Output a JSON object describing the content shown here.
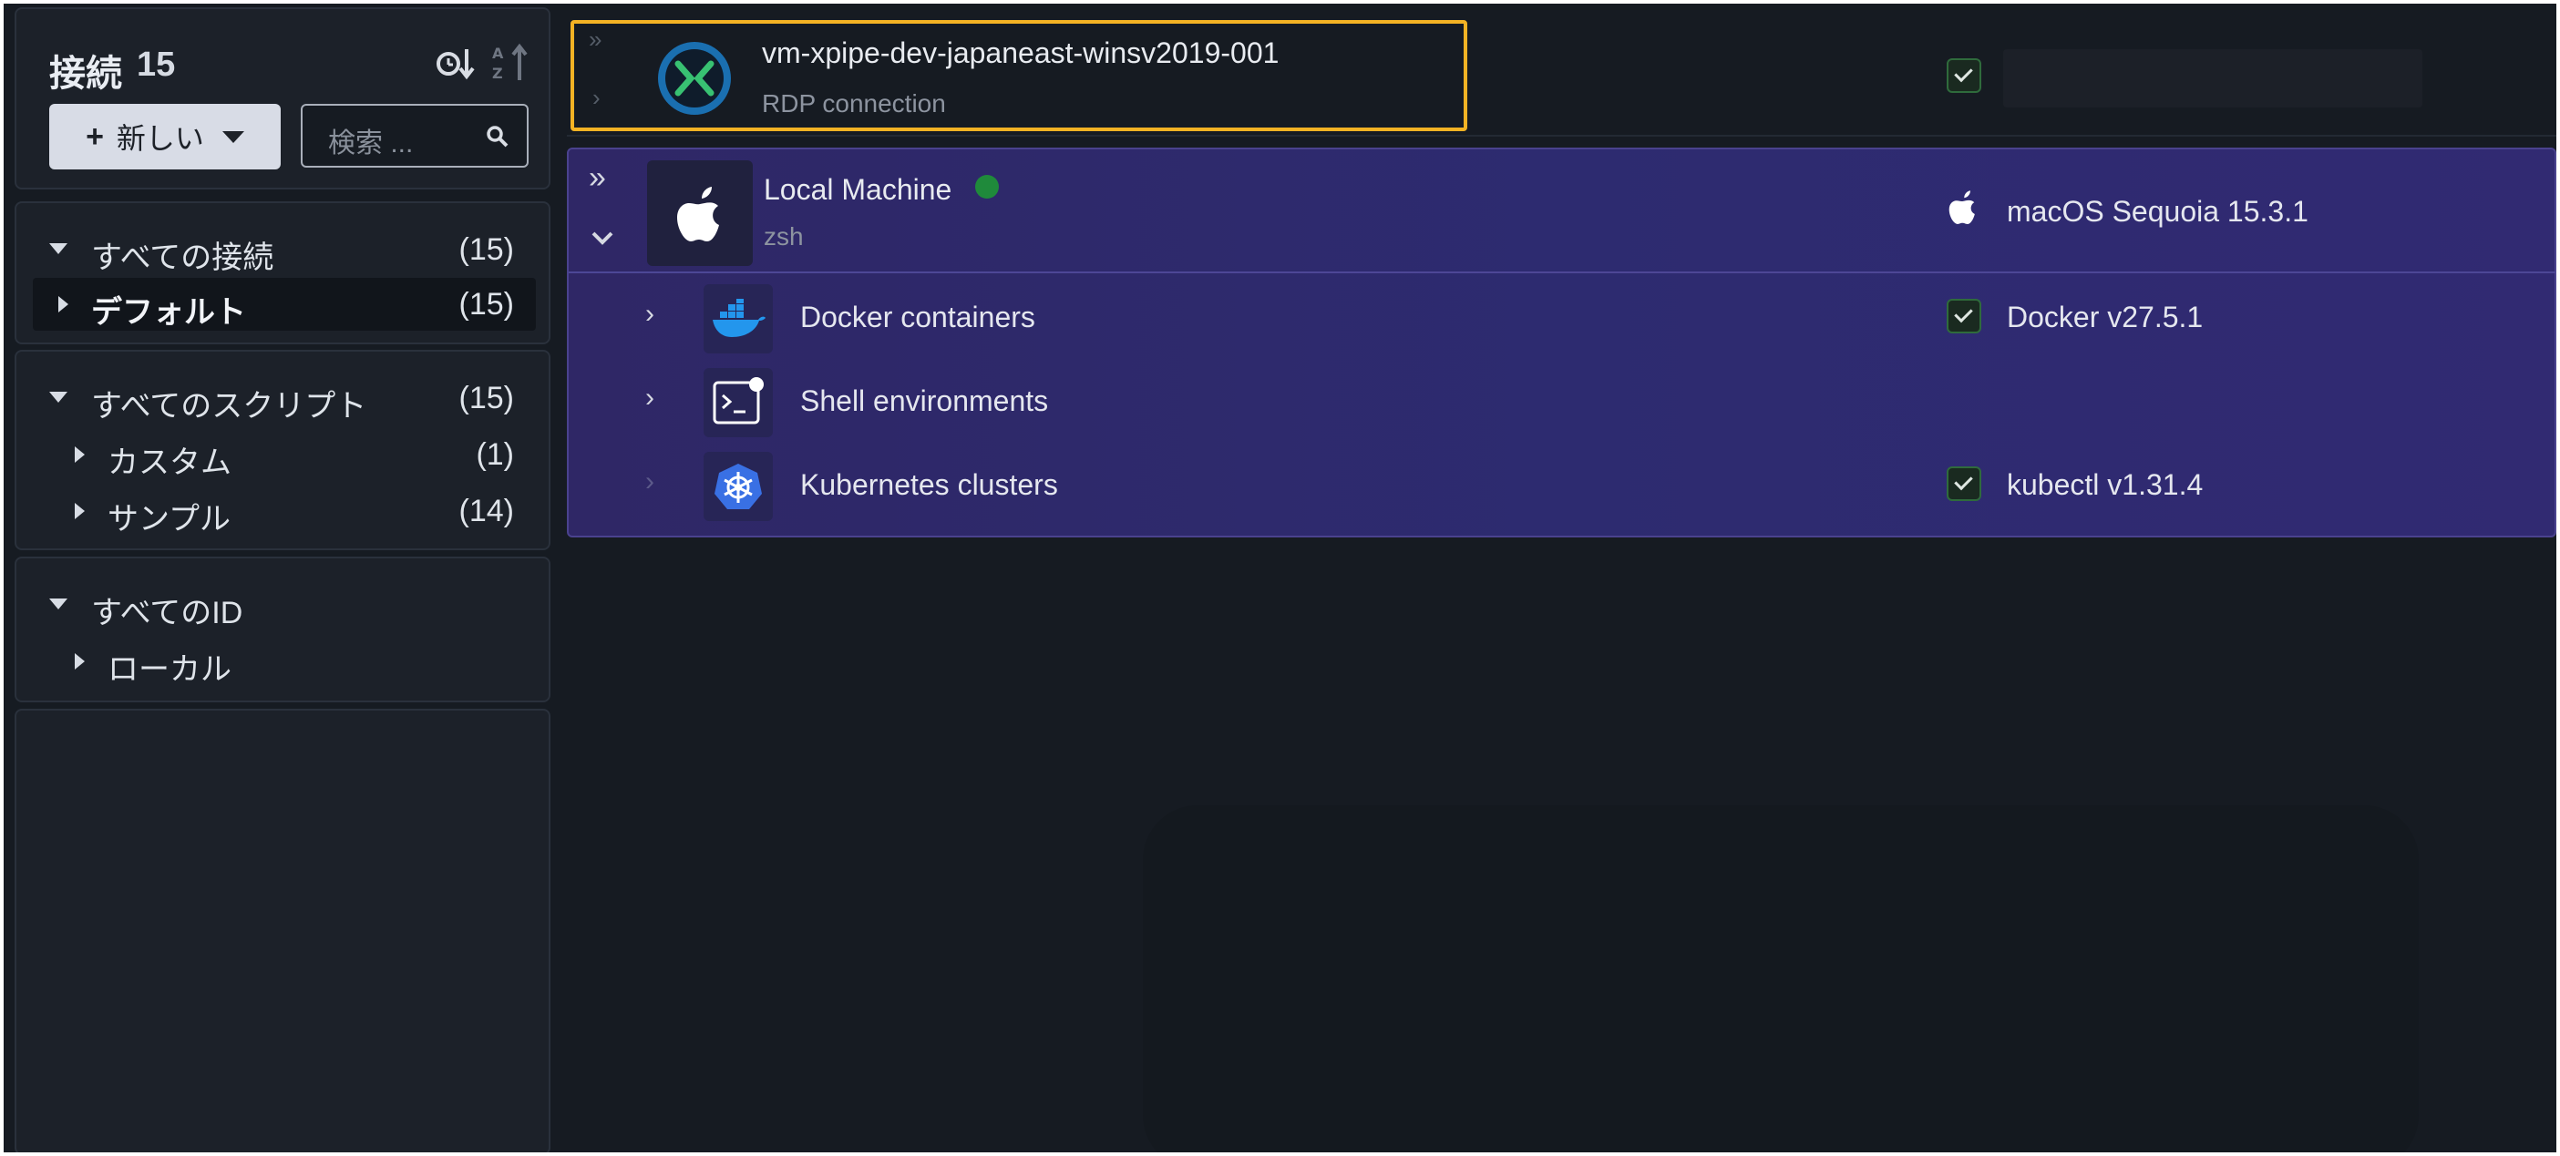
{
  "sidebar": {
    "title": "接続",
    "count": "15",
    "new_button": "新しい",
    "search_placeholder": "検索 ...",
    "connections": {
      "all_label": "すべての接続",
      "all_count": "(15)",
      "default_label": "デフォルト",
      "default_count": "(15)"
    },
    "scripts": {
      "all_label": "すべてのスクリプト",
      "all_count": "(15)",
      "custom_label": "カスタム",
      "custom_count": "(1)",
      "sample_label": "サンプル",
      "sample_count": "(14)"
    },
    "identities": {
      "all_label": "すべてのID",
      "local_label": "ローカル"
    }
  },
  "main": {
    "rdp": {
      "title": "vm-xpipe-dev-japaneast-winsv2019-001",
      "subtitle": "RDP connection"
    },
    "local": {
      "title": "Local Machine",
      "subtitle": "zsh",
      "os": "macOS Sequoia 15.3.1",
      "status_color": "#1f8a3b"
    },
    "children": [
      {
        "label": "Docker containers",
        "info": "Docker v27.5.1",
        "icon": "docker-icon"
      },
      {
        "label": "Shell environments",
        "info": "",
        "icon": "terminal-icon"
      },
      {
        "label": "Kubernetes clusters",
        "info": "kubectl v1.31.4",
        "icon": "kubernetes-icon"
      }
    ]
  },
  "colors": {
    "highlight": "#f4b324",
    "panel": "#2f2766",
    "background": "#161b22",
    "status_online": "#1f8a3b"
  }
}
